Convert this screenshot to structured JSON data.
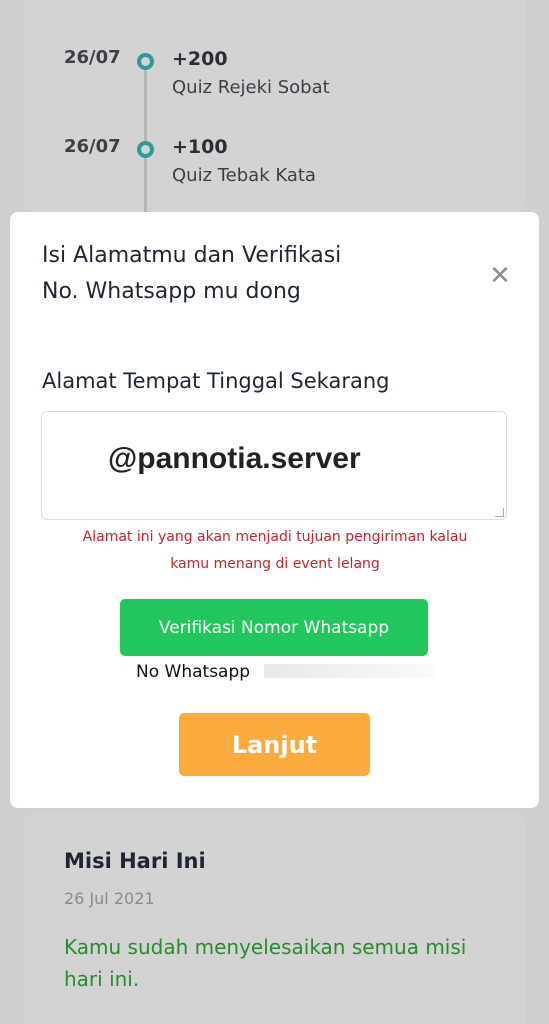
{
  "timeline": [
    {
      "date": "26/07",
      "points": "+200",
      "title": "Quiz Rejeki Sobat"
    },
    {
      "date": "26/07",
      "points": "+100",
      "title": "Quiz Tebak Kata"
    }
  ],
  "modal": {
    "title_line1": "Isi Alamatmu dan Verifikasi",
    "title_line2": "No. Whatsapp mu dong",
    "close_icon": "close-icon",
    "address_label": "Alamat Tempat Tinggal Sekarang",
    "address_value": "@pannotia.server",
    "warning_line1": "Alamat ini yang akan menjadi tujuan pengiriman kalau",
    "warning_line2": "kamu menang di event lelang",
    "verify_button": "Verifikasi Nomor Whatsapp",
    "whatsapp_label": "No Whatsapp",
    "next_button": "Lanjut"
  },
  "mission": {
    "title": "Misi Hari Ini",
    "date": "26 Jul 2021",
    "message": "Kamu sudah menyelesaikan semua misi hari ini."
  },
  "colors": {
    "accent_teal": "#2e9b96",
    "whatsapp_green": "#22c55e",
    "next_orange": "#fbaa3d",
    "warning_red": "#c0262d",
    "success_green": "#2a8a2e"
  }
}
